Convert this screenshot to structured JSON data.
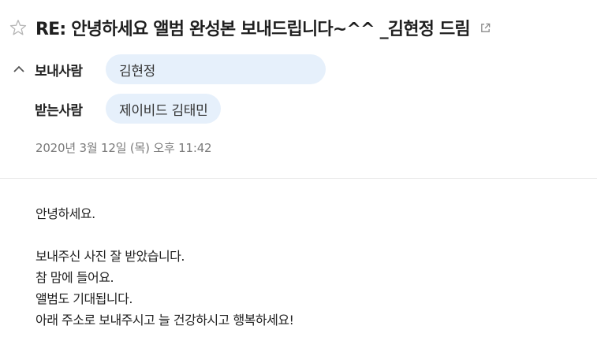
{
  "mail": {
    "subject": "RE: 안녕하세요 앨범 완성본 보내드립니다~^^ _김현정 드림",
    "star_icon": "star-outline-icon",
    "popout_icon": "external-link-icon",
    "from_label": "보내사람",
    "from_name": "김현정",
    "to_label": "받는사람",
    "to_name": "제이비드 김태민",
    "date": "2020년 3월 12일 (목) 오후 11:42",
    "body": {
      "greeting": "안녕하세요.",
      "line1": "보내주신 사진 잘 받았습니다.",
      "line2": "참 맘에 들어요.",
      "line3": "앨범도 기대됩니다.",
      "line4": "아래 주소로 보내주시고 늘 건강하시고 행복하세요!"
    }
  },
  "colors": {
    "chip_bg": "#e6f0fb",
    "date_text": "#7a7a7a",
    "divider": "#e8e8e8"
  }
}
